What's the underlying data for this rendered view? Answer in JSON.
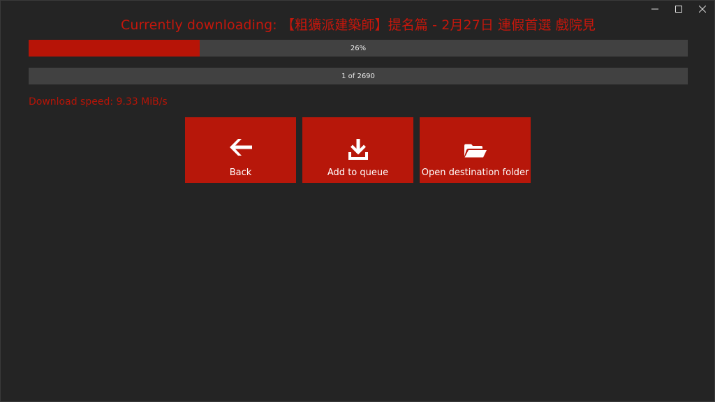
{
  "window": {
    "controls": {
      "minimize_icon": "minimize-icon",
      "maximize_icon": "maximize-icon",
      "close_icon": "close-icon"
    }
  },
  "header": {
    "title": "Currently downloading: 【粗獷派建築師】提名篇 - 2月27日 連假首選 戲院見"
  },
  "download_progress": {
    "value": 0.26,
    "label": "26%"
  },
  "queue_progress": {
    "current": 1,
    "total": 2690,
    "label": "1 of 2690"
  },
  "status": {
    "speed": "Download speed: 9.33 MiB/s"
  },
  "actions": [
    {
      "icon": "arrow-left-icon",
      "label": "Back"
    },
    {
      "icon": "download-icon",
      "label": "Add to queue"
    },
    {
      "icon": "folder-open-icon",
      "label": "Open destination folder"
    }
  ],
  "colors": {
    "accent": "#b7170a",
    "title": "#c4170c",
    "background": "#242424",
    "track": "#414141"
  }
}
